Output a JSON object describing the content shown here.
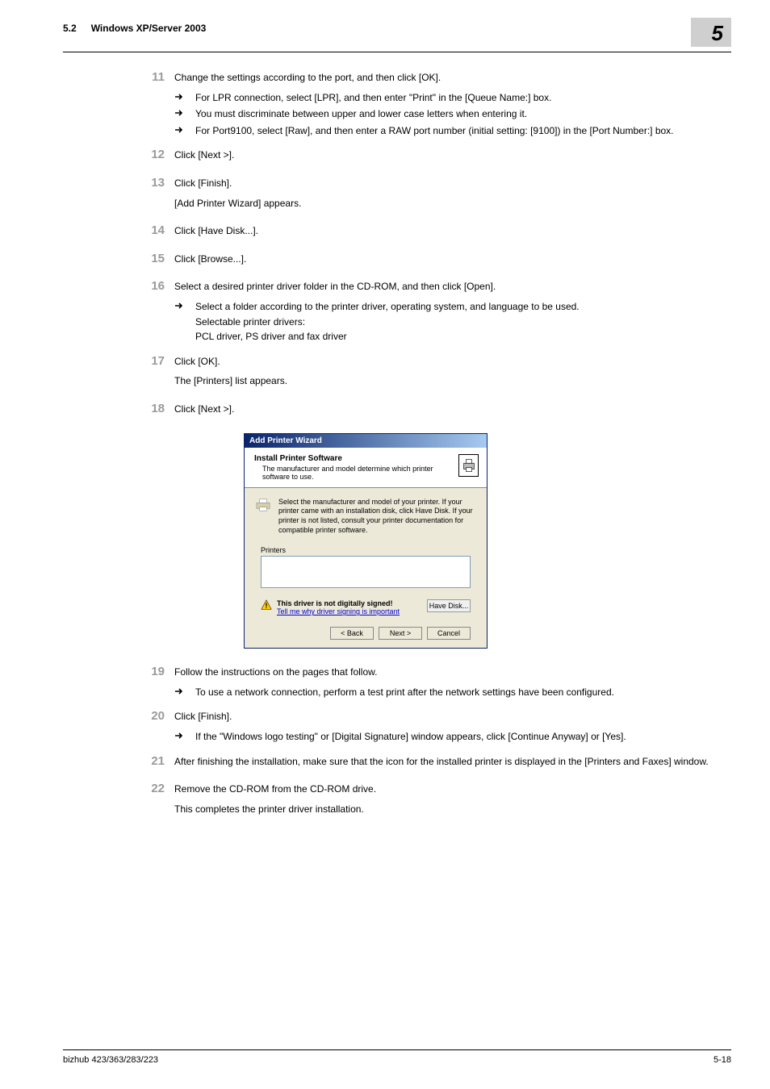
{
  "header": {
    "section_number": "5.2",
    "section_title": "Windows XP/Server 2003",
    "chapter_number": "5"
  },
  "steps": {
    "s11": {
      "num": "11",
      "text": "Change the settings according to the port, and then click [OK].",
      "subs": [
        "For LPR connection, select [LPR], and then enter \"Print\" in the [Queue Name:] box.",
        "You must discriminate between upper and lower case letters when entering it.",
        "For Port9100, select [Raw], and then enter a RAW port number (initial setting: [9100]) in the [Port Number:] box."
      ]
    },
    "s12": {
      "num": "12",
      "text": "Click [Next >]."
    },
    "s13": {
      "num": "13",
      "text": "Click [Finish].",
      "extra": "[Add Printer Wizard] appears."
    },
    "s14": {
      "num": "14",
      "text": "Click [Have Disk...]."
    },
    "s15": {
      "num": "15",
      "text": "Click [Browse...]."
    },
    "s16": {
      "num": "16",
      "text": "Select a desired printer driver folder in the CD-ROM, and then click [Open].",
      "subs_combined": "Select a folder according to the printer driver, operating system, and language to be used.\nSelectable printer drivers:\nPCL driver, PS driver and fax driver"
    },
    "s17": {
      "num": "17",
      "text": "Click [OK].",
      "extra": "The [Printers] list appears."
    },
    "s18": {
      "num": "18",
      "text": "Click [Next >]."
    },
    "s19": {
      "num": "19",
      "text": "Follow the instructions on the pages that follow.",
      "subs": [
        "To use a network connection, perform a test print after the network settings have been configured."
      ]
    },
    "s20": {
      "num": "20",
      "text": "Click [Finish].",
      "subs": [
        "If the \"Windows logo testing\" or [Digital Signature] window appears, click [Continue Anyway] or [Yes]."
      ]
    },
    "s21": {
      "num": "21",
      "text": "After finishing the installation, make sure that the icon for the installed printer is displayed in the [Printers and Faxes] window."
    },
    "s22": {
      "num": "22",
      "text": "Remove the CD-ROM from the CD-ROM drive.",
      "extra": "This completes the printer driver installation."
    }
  },
  "figure": {
    "title": "Add Printer Wizard",
    "head_title": "Install Printer Software",
    "head_sub": "The manufacturer and model determine which printer software to use.",
    "info": "Select the manufacturer and model of your printer. If your printer came with an installation disk, click Have Disk. If your printer is not listed, consult your printer documentation for compatible printer software.",
    "printers_label": "Printers",
    "list_item": "",
    "sign_bold": "This driver is not digitally signed!",
    "sign_link": "Tell me why driver signing is important",
    "buttons": {
      "hd": "Have Disk...",
      "back": "< Back",
      "next": "Next >",
      "cancel": "Cancel"
    }
  },
  "footer": {
    "left": "bizhub 423/363/283/223",
    "right": "5-18"
  }
}
